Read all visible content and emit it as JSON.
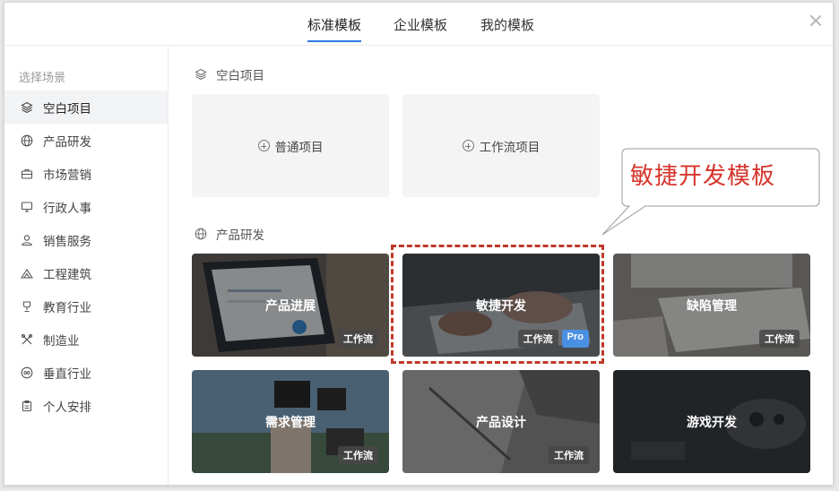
{
  "tabs": [
    {
      "label": "标准模板",
      "active": true
    },
    {
      "label": "企业模板",
      "active": false
    },
    {
      "label": "我的模板",
      "active": false
    }
  ],
  "sidebar": {
    "title": "选择场景",
    "items": [
      {
        "label": "空白项目",
        "icon": "layers-icon",
        "active": true
      },
      {
        "label": "产品研发",
        "icon": "globe-icon"
      },
      {
        "label": "市场营销",
        "icon": "briefcase-icon"
      },
      {
        "label": "行政人事",
        "icon": "monitor-icon"
      },
      {
        "label": "销售服务",
        "icon": "person-icon"
      },
      {
        "label": "工程建筑",
        "icon": "building-icon"
      },
      {
        "label": "教育行业",
        "icon": "trophy-icon"
      },
      {
        "label": "制造业",
        "icon": "tools-icon"
      },
      {
        "label": "垂直行业",
        "icon": "infinity-icon"
      },
      {
        "label": "个人安排",
        "icon": "clipboard-icon"
      }
    ]
  },
  "sections": {
    "blank": {
      "title": "空白项目",
      "cards": [
        {
          "label": "普通项目"
        },
        {
          "label": "工作流项目"
        }
      ]
    },
    "product": {
      "title": "产品研发",
      "templates": [
        {
          "name": "产品进展",
          "tags": [
            "工作流"
          ]
        },
        {
          "name": "敏捷开发",
          "tags": [
            "工作流",
            "Pro"
          ]
        },
        {
          "name": "缺陷管理",
          "tags": [
            "工作流"
          ]
        },
        {
          "name": "需求管理",
          "tags": [
            "工作流"
          ]
        },
        {
          "name": "产品设计",
          "tags": [
            "工作流"
          ]
        },
        {
          "name": "游戏开发",
          "tags": []
        }
      ]
    }
  },
  "annotation": {
    "text": "敏捷开发模板",
    "color": "#d6342b"
  },
  "colors": {
    "accent": "#2f7be6",
    "pro_badge": "#4a90e2",
    "annotation": "#c0392b"
  }
}
